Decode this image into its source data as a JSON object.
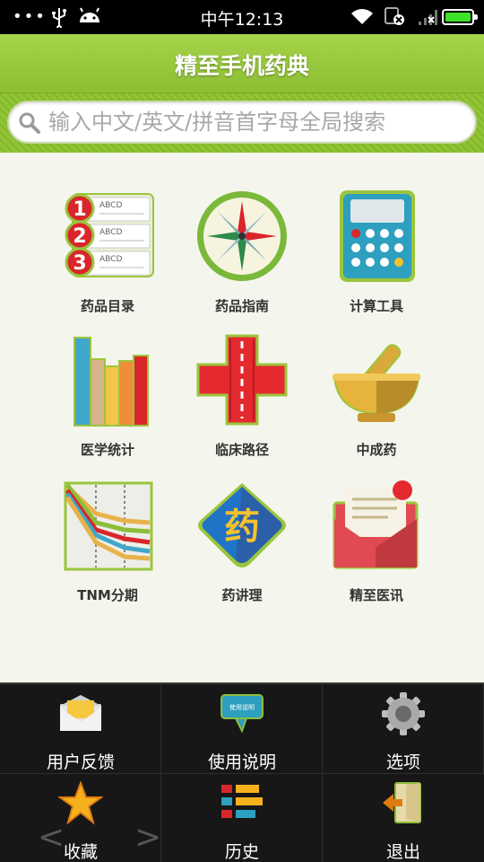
{
  "status_bar": {
    "time": "中午12:13",
    "icons": [
      "more-dots-icon",
      "usb-icon",
      "android-icon",
      "wifi-icon",
      "sim-off-icon",
      "signal-icon",
      "battery-icon"
    ],
    "battery_color": "#3fe028"
  },
  "header": {
    "title": "精至手机药典",
    "accent": "#8fc13a"
  },
  "search": {
    "placeholder": "输入中文/英文/拼音首字母全局搜索"
  },
  "grid": {
    "items": [
      {
        "label": "药品目录",
        "icon": "numbered-list-icon"
      },
      {
        "label": "药品指南",
        "icon": "compass-icon"
      },
      {
        "label": "计算工具",
        "icon": "calculator-icon"
      },
      {
        "label": "医学统计",
        "icon": "bar-chart-icon"
      },
      {
        "label": "临床路径",
        "icon": "red-cross-road-icon"
      },
      {
        "label": "中成药",
        "icon": "mortar-pestle-icon"
      },
      {
        "label": "TNM分期",
        "icon": "line-chart-icon"
      },
      {
        "label": "药讲理",
        "icon": "medicine-badge-icon"
      },
      {
        "label": "精至医讯",
        "icon": "envelope-news-icon"
      }
    ],
    "badge_text": "药",
    "calc_sample": "ABCD"
  },
  "menu": {
    "items": [
      {
        "label": "用户反馈",
        "icon": "envelope-icon"
      },
      {
        "label": "使用说明",
        "icon": "speech-bubble-icon"
      },
      {
        "label": "选项",
        "icon": "gear-icon"
      },
      {
        "label": "收藏",
        "icon": "star-icon"
      },
      {
        "label": "历史",
        "icon": "history-list-icon"
      },
      {
        "label": "退出",
        "icon": "exit-door-icon"
      }
    ],
    "bubble_text": "使用说明"
  }
}
